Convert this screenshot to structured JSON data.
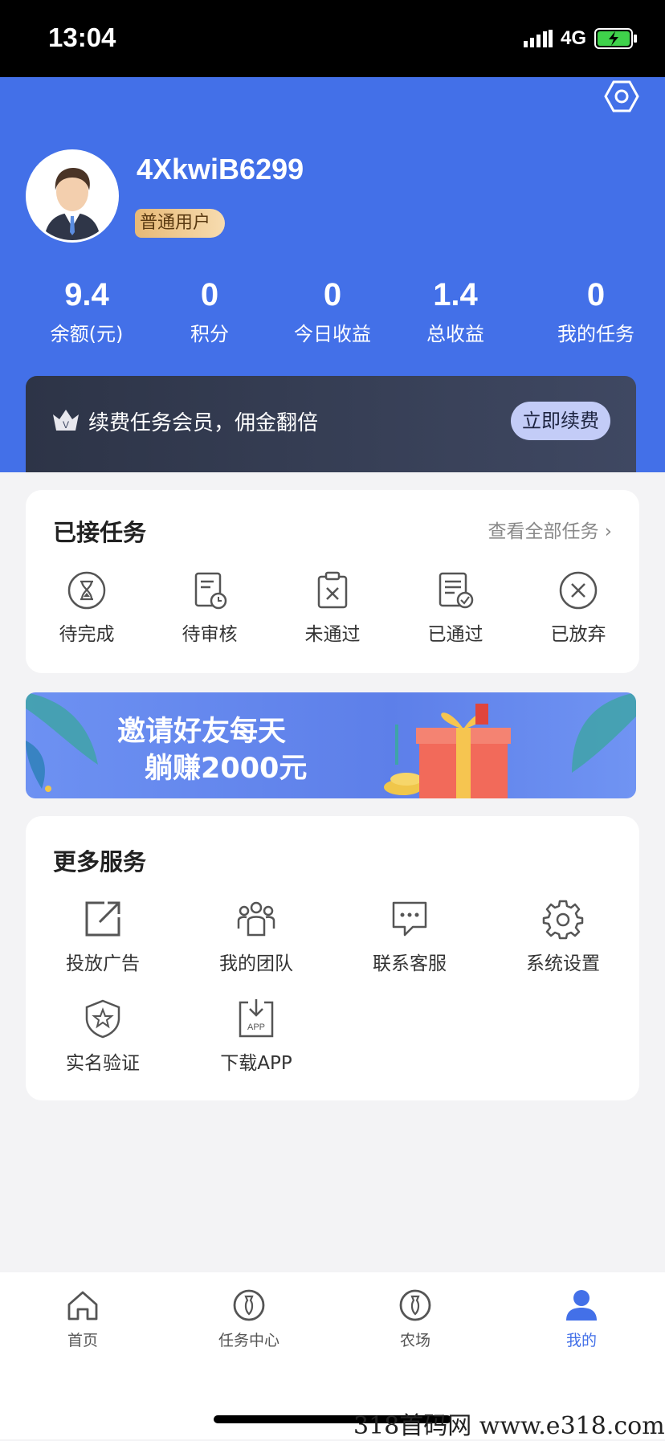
{
  "status_bar": {
    "time": "13:04",
    "network": "4G",
    "battery_icon": "battery-charging-icon"
  },
  "profile": {
    "username": "4XkwiB6299",
    "badge": "普通用户"
  },
  "stats": [
    {
      "value": "9.4",
      "label": "余额(元)"
    },
    {
      "value": "0",
      "label": "积分"
    },
    {
      "value": "0",
      "label": "今日收益"
    },
    {
      "value": "1.4",
      "label": "总收益"
    },
    {
      "value": "0",
      "label": "我的任务"
    }
  ],
  "vip": {
    "text": "续费任务会员，佣金翻倍",
    "button": "立即续费"
  },
  "tasks": {
    "title": "已接任务",
    "view_all": "查看全部任务",
    "items": [
      {
        "label": "待完成",
        "icon": "hourglass-icon"
      },
      {
        "label": "待审核",
        "icon": "document-clock-icon"
      },
      {
        "label": "未通过",
        "icon": "clipboard-x-icon"
      },
      {
        "label": "已通过",
        "icon": "document-check-icon"
      },
      {
        "label": "已放弃",
        "icon": "circle-x-icon"
      }
    ]
  },
  "banner": {
    "line1": "邀请好友每天",
    "line2": "躺赚2000元"
  },
  "services": {
    "title": "更多服务",
    "items": [
      {
        "label": "投放广告",
        "icon": "external-link-icon"
      },
      {
        "label": "我的团队",
        "icon": "team-icon"
      },
      {
        "label": "联系客服",
        "icon": "chat-icon"
      },
      {
        "label": "系统设置",
        "icon": "gear-icon"
      },
      {
        "label": "实名验证",
        "icon": "shield-star-icon"
      },
      {
        "label": "下载APP",
        "icon": "download-app-icon"
      }
    ]
  },
  "tabbar": {
    "items": [
      {
        "label": "首页",
        "icon": "home-icon"
      },
      {
        "label": "任务中心",
        "icon": "task-center-icon"
      },
      {
        "label": "农场",
        "icon": "farm-icon"
      },
      {
        "label": "我的",
        "icon": "user-icon"
      }
    ],
    "active_index": 3
  },
  "watermark": "318首码网 www.e318.com",
  "colors": {
    "primary": "#4370e8",
    "vip_bg": "#2d3447",
    "badge_gold": "#e7b976"
  }
}
